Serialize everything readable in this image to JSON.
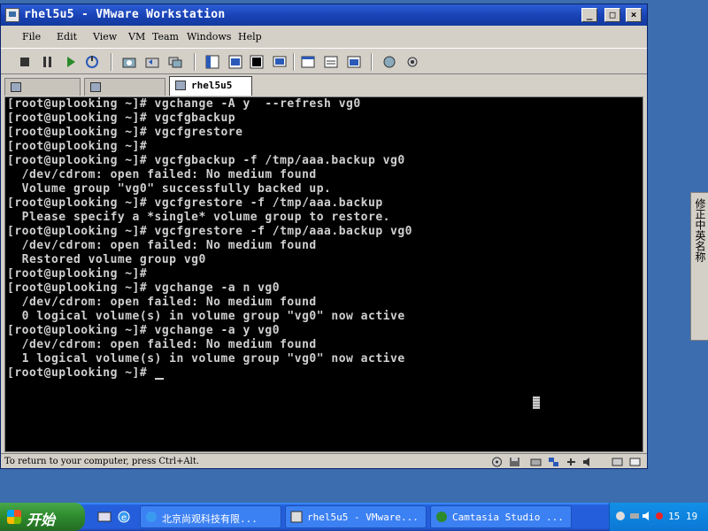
{
  "window": {
    "title": "rhel5u5 - VMware Workstation",
    "minimize_label": "_",
    "maximize_label": "□",
    "close_label": "×"
  },
  "menu": [
    "File",
    "Edit",
    "View",
    "VM",
    "Team",
    "Windows",
    "Help"
  ],
  "tabs": [
    {
      "label": ""
    },
    {
      "label": ""
    },
    {
      "label": "rhel5u5",
      "active": true
    }
  ],
  "console": {
    "lines": [
      "[root@uplooking ~]# vgchange -A y  --refresh vg0",
      "[root@uplooking ~]# vgcfgbackup",
      "[root@uplooking ~]# vgcfgrestore",
      "[root@uplooking ~]#",
      "[root@uplooking ~]# vgcfgbackup -f /tmp/aaa.backup vg0",
      "  /dev/cdrom: open failed: No medium found",
      "  Volume group \"vg0\" successfully backed up.",
      "[root@uplooking ~]# vgcfgrestore -f /tmp/aaa.backup",
      "  Please specify a *single* volume group to restore.",
      "[root@uplooking ~]# vgcfgrestore -f /tmp/aaa.backup vg0",
      "  /dev/cdrom: open failed: No medium found",
      "  Restored volume group vg0",
      "[root@uplooking ~]#",
      "[root@uplooking ~]# vgchange -a n vg0",
      "  /dev/cdrom: open failed: No medium found",
      "  0 logical volume(s) in volume group \"vg0\" now active",
      "[root@uplooking ~]# vgchange -a y vg0",
      "  /dev/cdrom: open failed: No medium found",
      "  1 logical volume(s) in volume group \"vg0\" now active"
    ],
    "prompt": "[root@uplooking ~]# "
  },
  "statusbar": {
    "text": "To return to your computer, press Ctrl+Alt."
  },
  "side_panel": {
    "text": "修正中英名称"
  },
  "taskbar": {
    "start_label": "开始",
    "tasks": [
      {
        "label": "北京尚观科技有限..."
      },
      {
        "label": "rhel5u5 - VMware..."
      },
      {
        "label": "Camtasia Studio ..."
      }
    ],
    "clock": "15 19"
  },
  "colors": {
    "titlebar": "#1a44b8",
    "console_bg": "#000000",
    "console_fg": "#d0d0d0",
    "desktop": "#3c6dae",
    "taskbar": "#245edb",
    "start": "#2d8a2d"
  }
}
